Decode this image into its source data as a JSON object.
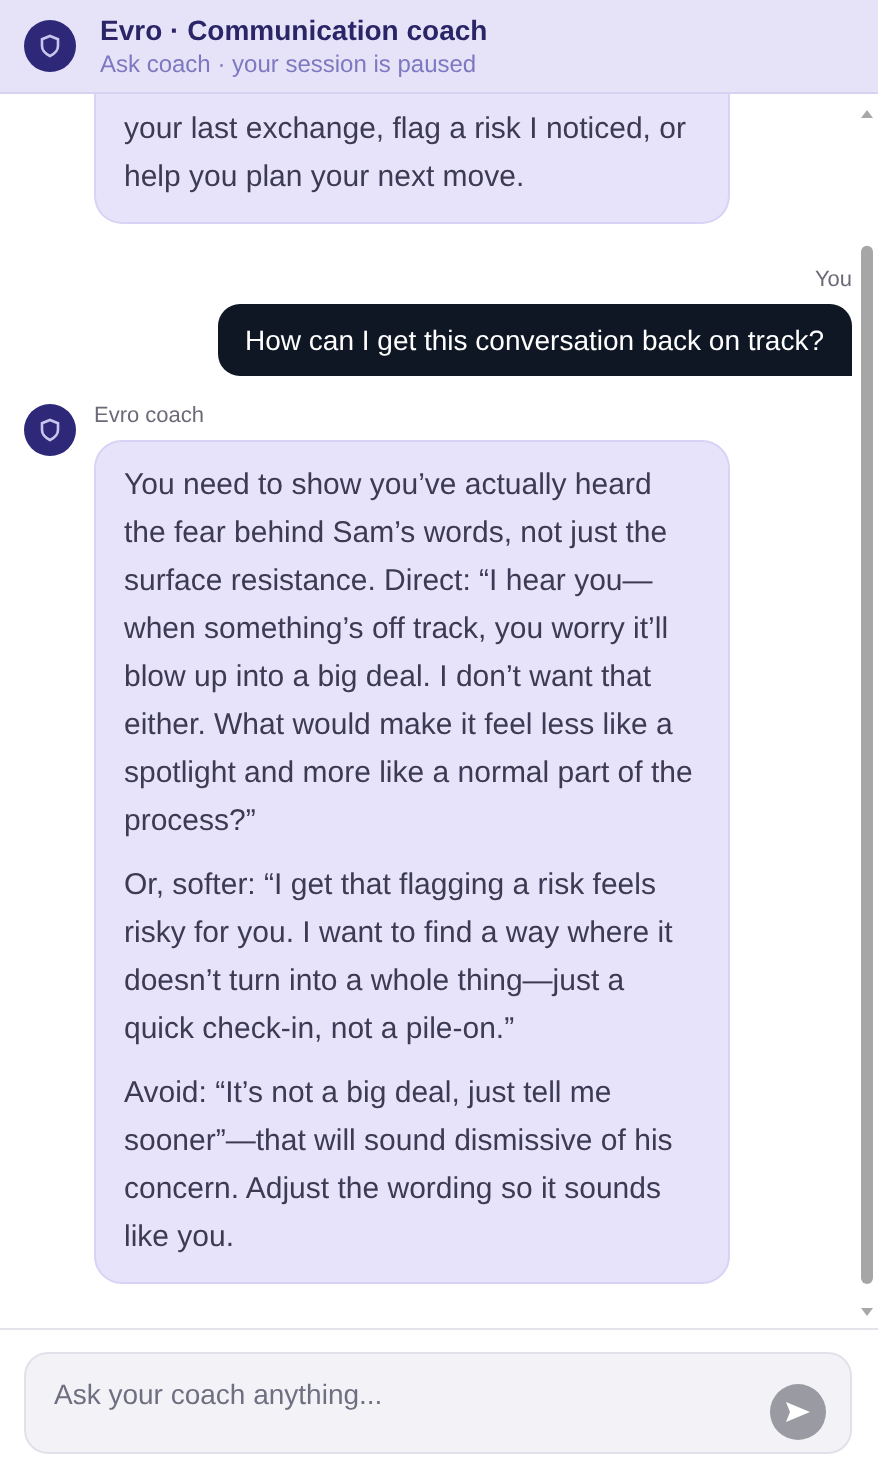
{
  "header": {
    "title": "Evro · Communication coach",
    "subtitle": "Ask coach · your session is paused"
  },
  "messages": [
    {
      "kind": "coach",
      "cut_off": true,
      "paragraphs": [
        "your last exchange, flag a risk I noticed, or help you plan your next move."
      ]
    },
    {
      "kind": "user",
      "sender": "You",
      "paragraphs": [
        "How can I get this conversation back on track?"
      ]
    },
    {
      "kind": "coach",
      "cut_off": false,
      "sender": "Evro coach",
      "paragraphs": [
        "You need to show you’ve actually heard the fear behind Sam’s words, not just the surface resistance. Direct: “I hear you—when something’s off track, you worry it’ll blow up into a big deal. I don’t want that either. What would make it feel less like a spotlight and more like a normal part of the process?”",
        "Or, softer: “I get that flagging a risk feels risky for you. I want to find a way where it doesn’t turn into a whole thing—just a quick check-in, not a pile-on.”",
        "Avoid: “It’s not a big deal, just tell me sooner”—that will sound dismissive of his concern. Adjust the wording so it sounds like you."
      ]
    }
  ],
  "composer": {
    "placeholder": "Ask your coach anything..."
  }
}
